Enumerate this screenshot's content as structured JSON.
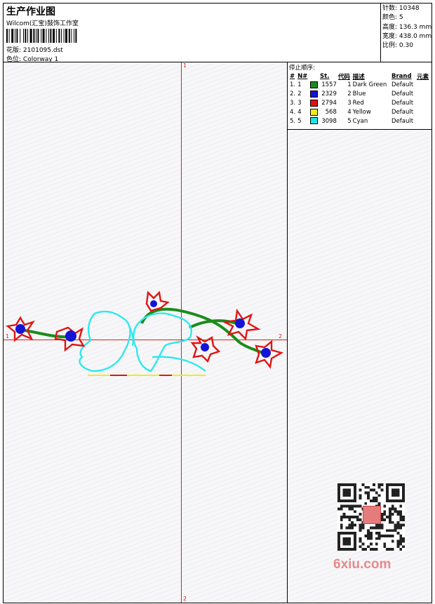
{
  "header": {
    "title": "生产作业图",
    "studio": "Wilcom(汇宝)鼓饰工作室",
    "file_label": "花版:",
    "file_value": "2101095.dst",
    "colorway_label": "色位:",
    "colorway_value": "Colorway 1"
  },
  "stats": [
    {
      "label": "针数:",
      "value": "10348"
    },
    {
      "label": "颜色:",
      "value": "5"
    },
    {
      "label": "高度:",
      "value": "136.3 mm"
    },
    {
      "label": "宽度:",
      "value": "438.0 mm"
    },
    {
      "label": "比例:",
      "value": "0.30"
    }
  ],
  "stop_sequence": {
    "title": "停止顺序:",
    "columns": [
      "#",
      "N#",
      "St.",
      "代码",
      "描述",
      "Brand",
      "元素"
    ],
    "rows": [
      {
        "idx": "1.",
        "n": "1",
        "color": "#1a8c1a",
        "st": "1557",
        "code": "1",
        "desc": "Dark Green",
        "brand": "Default"
      },
      {
        "idx": "2.",
        "n": "2",
        "color": "#1414d6",
        "st": "2329",
        "code": "2",
        "desc": "Blue",
        "brand": "Default"
      },
      {
        "idx": "3.",
        "n": "3",
        "color": "#e01414",
        "st": "2794",
        "code": "3",
        "desc": "Red",
        "brand": "Default"
      },
      {
        "idx": "4.",
        "n": "4",
        "color": "#f2ea1e",
        "st": "568",
        "code": "4",
        "desc": "Yellow",
        "brand": "Default"
      },
      {
        "idx": "5.",
        "n": "5",
        "color": "#1ee6e6",
        "st": "3098",
        "code": "5",
        "desc": "Cyan",
        "brand": "Default"
      }
    ]
  },
  "axis_labels": {
    "top": "1",
    "bottom": "2",
    "left": "1",
    "right": "2"
  },
  "watermark": {
    "text": "6xiu.com"
  }
}
